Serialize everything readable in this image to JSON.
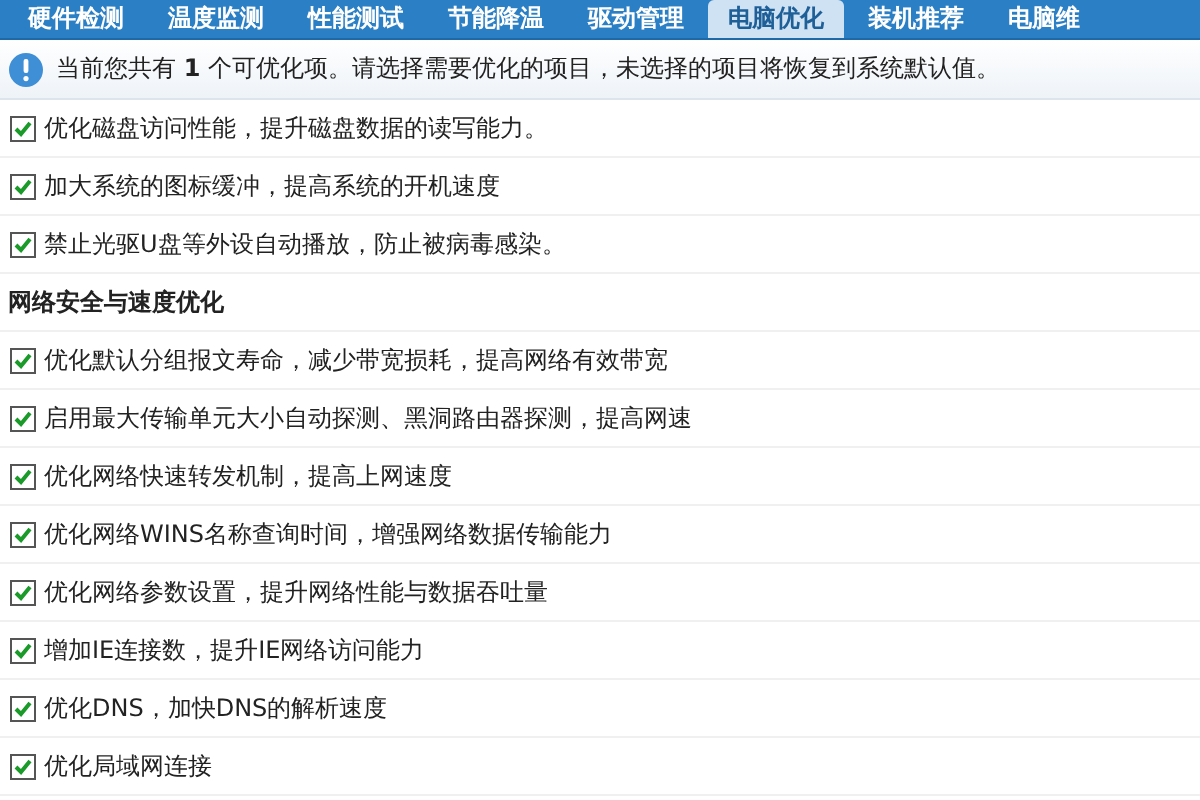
{
  "tabs": [
    {
      "label": "硬件检测",
      "selected": false
    },
    {
      "label": "温度监测",
      "selected": false
    },
    {
      "label": "性能测试",
      "selected": false
    },
    {
      "label": "节能降温",
      "selected": false
    },
    {
      "label": "驱动管理",
      "selected": false
    },
    {
      "label": "电脑优化",
      "selected": true
    },
    {
      "label": "装机推荐",
      "selected": false
    },
    {
      "label": "电脑维",
      "selected": false
    }
  ],
  "notice": "当前您共有 **1** 个可优化项。请选择需要优化的项目，未选择的项目将恢复到系统默认值。",
  "rows": [
    {
      "kind": "option",
      "label": "优化磁盘访问性能，提升磁盘数据的读写能力。",
      "checked": true
    },
    {
      "kind": "option",
      "label": "加大系统的图标缓冲，提高系统的开机速度",
      "checked": true
    },
    {
      "kind": "option",
      "label": "禁止光驱U盘等外设自动播放，防止被病毒感染。",
      "checked": true
    },
    {
      "kind": "heading",
      "label": "网络安全与速度优化"
    },
    {
      "kind": "option",
      "label": "优化默认分组报文寿命，减少带宽损耗，提高网络有效带宽",
      "checked": true
    },
    {
      "kind": "option",
      "label": "启用最大传输单元大小自动探测、黑洞路由器探测，提高网速",
      "checked": true
    },
    {
      "kind": "option",
      "label": "优化网络快速转发机制，提高上网速度",
      "checked": true
    },
    {
      "kind": "option",
      "label": "优化网络WINS名称查询时间，增强网络数据传输能力",
      "checked": true
    },
    {
      "kind": "option",
      "label": "优化网络参数设置，提升网络性能与数据吞吐量",
      "checked": true
    },
    {
      "kind": "option",
      "label": "增加IE连接数，提升IE网络访问能力",
      "checked": true
    },
    {
      "kind": "option",
      "label": "优化DNS，加快DNS的解析速度",
      "checked": true
    },
    {
      "kind": "option",
      "label": "优化局域网连接",
      "checked": true
    }
  ]
}
